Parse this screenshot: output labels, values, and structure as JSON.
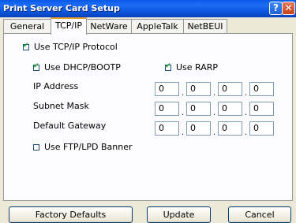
{
  "window": {
    "title": "Print Server Card Setup",
    "help_glyph": "?",
    "close_glyph": "✕"
  },
  "tabs": [
    "General",
    "TCP/IP",
    "NetWare",
    "AppleTalk",
    "NetBEUI"
  ],
  "active_tab": "TCP/IP",
  "tcpip": {
    "use_tcpip": {
      "label": "Use TCP/IP Protocol",
      "checked": true
    },
    "use_dhcp": {
      "label": "Use DHCP/BOOTP",
      "checked": true
    },
    "use_rarp": {
      "label": "Use RARP",
      "checked": true
    },
    "ip_address": {
      "label": "IP Address",
      "octets": [
        "0",
        "0",
        "0",
        "0"
      ]
    },
    "subnet_mask": {
      "label": "Subnet Mask",
      "octets": [
        "0",
        "0",
        "0",
        "0"
      ]
    },
    "default_gateway": {
      "label": "Default Gateway",
      "octets": [
        "0",
        "0",
        "0",
        "0"
      ]
    },
    "ftp_lpd_banner": {
      "label": "Use FTP/LPD Banner",
      "checked": false
    },
    "octet_separator": "."
  },
  "buttons": {
    "factory_defaults": "Factory Defaults",
    "update": "Update",
    "cancel": "Cancel"
  },
  "colors": {
    "titlebar": "#0b54dc",
    "active_tab_accent": "#e8a032",
    "dialog_bg": "#ece9d8",
    "check_mark": "#21a121"
  }
}
